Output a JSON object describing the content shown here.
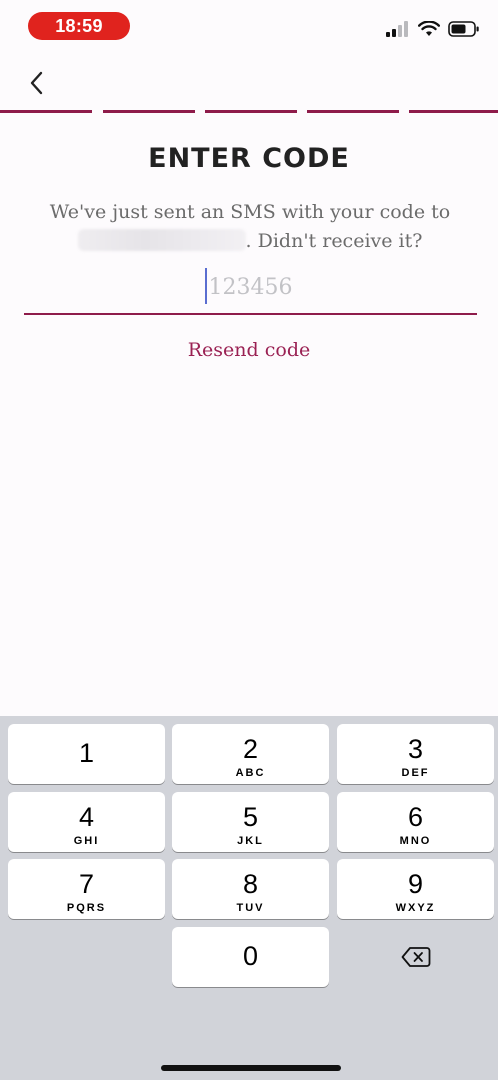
{
  "status_bar": {
    "time": "18:59"
  },
  "header": {
    "title": "ENTER CODE"
  },
  "subtitle": {
    "line1": "We've just sent an SMS with your code to",
    "line2_suffix": ". Didn't receive it?"
  },
  "code_input": {
    "placeholder": "123456",
    "value": ""
  },
  "resend_label": "Resend code",
  "progress": {
    "segments": 5,
    "completed": 5,
    "color": "#8e1b4a"
  },
  "keypad": {
    "keys": [
      {
        "digit": "1",
        "letters": ""
      },
      {
        "digit": "2",
        "letters": "ABC"
      },
      {
        "digit": "3",
        "letters": "DEF"
      },
      {
        "digit": "4",
        "letters": "GHI"
      },
      {
        "digit": "5",
        "letters": "JKL"
      },
      {
        "digit": "6",
        "letters": "MNO"
      },
      {
        "digit": "7",
        "letters": "PQRS"
      },
      {
        "digit": "8",
        "letters": "TUV"
      },
      {
        "digit": "9",
        "letters": "WXYZ"
      },
      {
        "digit": "0",
        "letters": ""
      }
    ]
  },
  "icons": {
    "back": "chevron-left-icon",
    "signal": "cellular-signal-icon",
    "wifi": "wifi-icon",
    "battery": "battery-icon",
    "delete": "backspace-icon"
  },
  "colors": {
    "accent": "#8e1b4a",
    "link": "#9a2153",
    "time_pill": "#e0231e",
    "keyboard_bg": "#d1d3d9"
  }
}
